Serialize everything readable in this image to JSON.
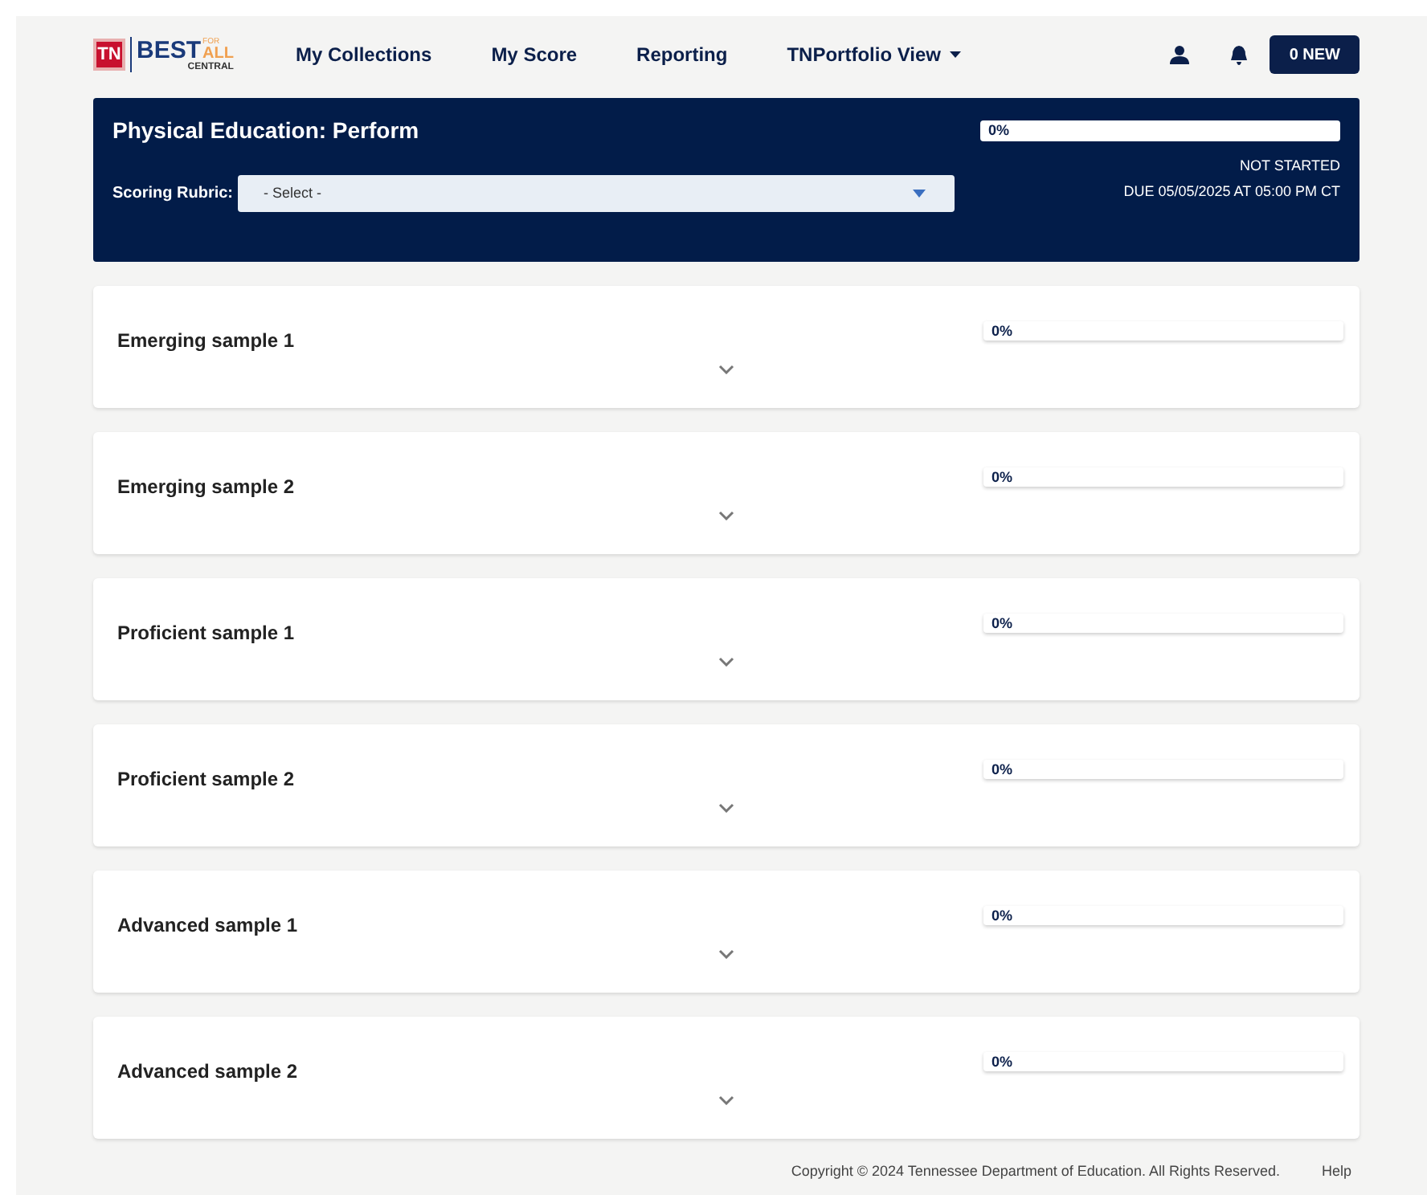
{
  "logo": {
    "badge": "TN",
    "word": "BEST",
    "for": "FOR",
    "all": "ALL",
    "sub": "CENTRAL"
  },
  "nav": [
    {
      "label": "My Collections",
      "dropdown": false
    },
    {
      "label": "My Score",
      "dropdown": false
    },
    {
      "label": "Reporting",
      "dropdown": false
    },
    {
      "label": "TNPortfolio View",
      "dropdown": true
    }
  ],
  "new_button": "0 NEW",
  "header": {
    "title": "Physical Education: Perform",
    "rubric_label": "Scoring Rubric:",
    "rubric_value": "- Select -",
    "progress": {
      "level": 0,
      "reading": "0%"
    },
    "status": "NOT STARTED",
    "due": "DUE 05/05/2025 AT 05:00 PM CT"
  },
  "samples": [
    {
      "title": "Emerging sample 1",
      "level": 0,
      "reading": "0%",
      "expanded": false
    },
    {
      "title": "Emerging sample 2",
      "level": 0,
      "reading": "0%",
      "expanded": false
    },
    {
      "title": "Proficient sample 1",
      "level": 0,
      "reading": "0%",
      "expanded": false
    },
    {
      "title": "Proficient sample 2",
      "level": 0,
      "reading": "0%",
      "expanded": false
    },
    {
      "title": "Advanced sample 1",
      "level": 0,
      "reading": "0%",
      "expanded": false
    },
    {
      "title": "Advanced sample 2",
      "level": 0,
      "reading": "0%",
      "expanded": false
    }
  ],
  "footer": {
    "copyright": "Copyright © 2024 Tennessee Department of Education. All Rights Reserved.",
    "help": "Help"
  }
}
